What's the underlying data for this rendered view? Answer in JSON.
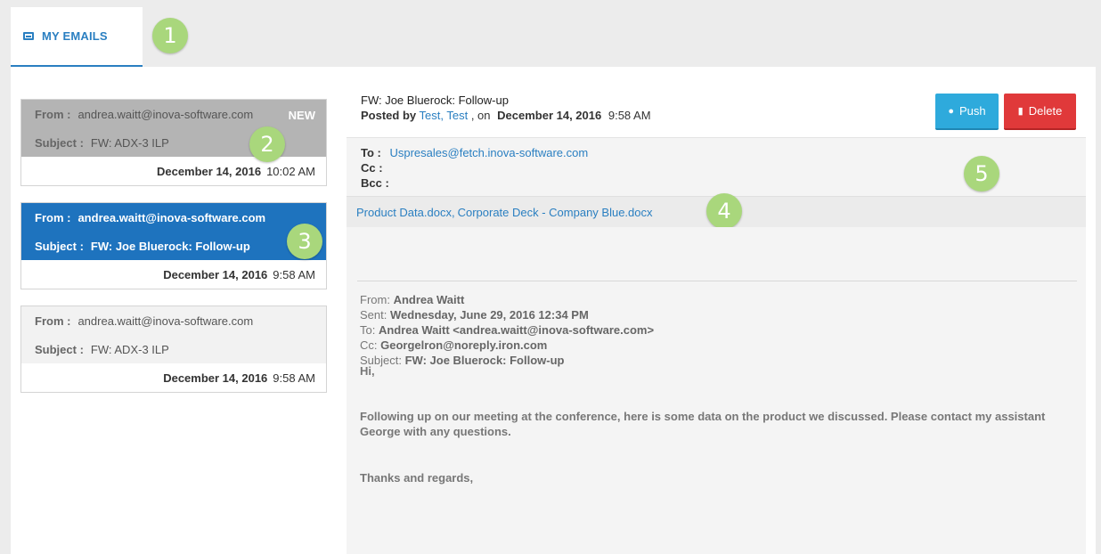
{
  "tabs": [
    {
      "label": "MY EMAILS"
    }
  ],
  "badges": [
    "1",
    "2",
    "3",
    "4",
    "5"
  ],
  "emails": [
    {
      "from_label": "From :",
      "from": "andrea.waitt@inova-software.com",
      "subject_label": "Subject :",
      "subject": "FW: ADX-3 ILP",
      "date": "December 14, 2016",
      "time": "10:02 AM",
      "tag": "NEW"
    },
    {
      "from_label": "From :",
      "from": "andrea.waitt@inova-software.com",
      "subject_label": "Subject :",
      "subject": "FW: Joe Bluerock: Follow-up",
      "date": "December 14, 2016",
      "time": "9:58 AM"
    },
    {
      "from_label": "From :",
      "from": "andrea.waitt@inova-software.com",
      "subject_label": "Subject :",
      "subject": "FW: ADX-3 ILP",
      "date": "December 14, 2016",
      "time": "9:58 AM"
    }
  ],
  "detail": {
    "subject": "FW: Joe Bluerock: Follow-up",
    "posted_by_label": "Posted by",
    "posted_by": "Test, Test",
    "on_label": ", on",
    "date": "December 14, 2016",
    "time": "9:58 AM",
    "push_label": "Push",
    "delete_label": "Delete",
    "to_label": "To :",
    "to": "Uspresales@fetch.inova-software.com",
    "cc_label": "Cc :",
    "bcc_label": "Bcc :",
    "attachments": [
      "Product Data.docx",
      "Corporate Deck - Company Blue.docx"
    ],
    "attachment_separator": ",",
    "quoted": {
      "from_label": "From:",
      "from": "Andrea Waitt",
      "sent_label": "Sent:",
      "sent": "Wednesday, June 29, 2016 12:34 PM",
      "to_label": "To:",
      "to": "Andrea Waitt <andrea.waitt@inova-software.com>",
      "cc_label": "Cc:",
      "cc": "Georgelron@noreply.iron.com",
      "subject_label": "Subject:",
      "subject": "FW: Joe Bluerock: Follow-up"
    },
    "greeting": "Hi,",
    "message": "Following up on our meeting at the conference, here is some data on the product we discussed. Please contact my assistant George with any questions.",
    "closing": "Thanks and regards,"
  },
  "colors": {
    "accent": "#2a7fc1",
    "selected": "#1e73be",
    "push": "#2eaadc",
    "delete": "#e0393a",
    "badge": "#a9d77c"
  }
}
